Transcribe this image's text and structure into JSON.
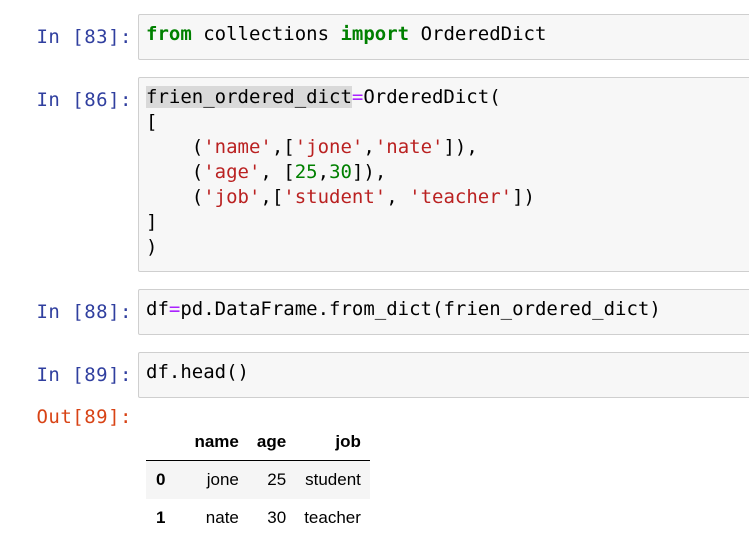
{
  "cells": [
    {
      "prompt": "In [83]:",
      "lines": [
        [
          [
            "kw",
            "from"
          ],
          [
            "t",
            " collections "
          ],
          [
            "kw",
            "import"
          ],
          [
            "t",
            " OrderedDict"
          ]
        ]
      ]
    },
    {
      "prompt": "In [86]:",
      "lines": [
        [
          [
            "sel",
            "frien_ordered_dict"
          ],
          [
            "op",
            "="
          ],
          [
            "t",
            "OrderedDict("
          ]
        ],
        [
          [
            "t",
            "["
          ]
        ],
        [
          [
            "t",
            "    ("
          ],
          [
            "str",
            "'name'"
          ],
          [
            "t",
            ",["
          ],
          [
            "str",
            "'jone'"
          ],
          [
            "t",
            ","
          ],
          [
            "str",
            "'nate'"
          ],
          [
            "t",
            "]),"
          ]
        ],
        [
          [
            "t",
            "    ("
          ],
          [
            "str",
            "'age'"
          ],
          [
            "t",
            ", ["
          ],
          [
            "num",
            "25"
          ],
          [
            "t",
            ","
          ],
          [
            "num",
            "30"
          ],
          [
            "t",
            "]),"
          ]
        ],
        [
          [
            "t",
            "    ("
          ],
          [
            "str",
            "'job'"
          ],
          [
            "t",
            ",["
          ],
          [
            "str",
            "'student'"
          ],
          [
            "t",
            ", "
          ],
          [
            "str",
            "'teacher'"
          ],
          [
            "t",
            "])"
          ]
        ],
        [
          [
            "t",
            "]"
          ]
        ],
        [
          [
            "t",
            ")"
          ]
        ]
      ]
    },
    {
      "prompt": "In [88]:",
      "lines": [
        [
          [
            "t",
            "df"
          ],
          [
            "op",
            "="
          ],
          [
            "t",
            "pd.DataFrame.from_dict(frien_ordered_dict)"
          ]
        ]
      ]
    },
    {
      "prompt": "In [89]:",
      "lines": [
        [
          [
            "t",
            "df.head()"
          ]
        ]
      ]
    }
  ],
  "output": {
    "prompt": "Out[89]:",
    "columns": [
      "",
      "name",
      "age",
      "job"
    ],
    "rows": [
      [
        "0",
        "jone",
        "25",
        "student"
      ],
      [
        "1",
        "nate",
        "30",
        "teacher"
      ]
    ]
  }
}
